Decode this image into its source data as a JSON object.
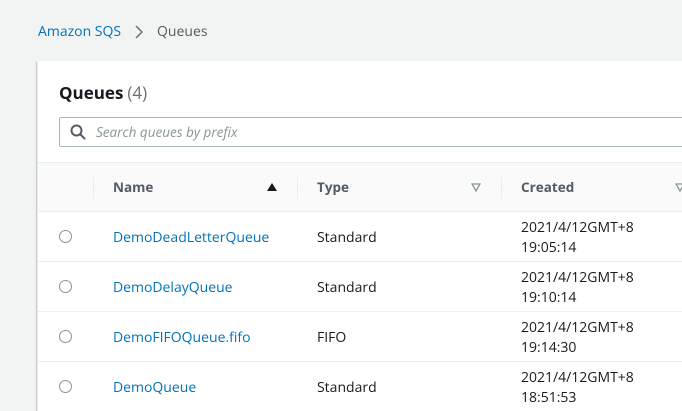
{
  "breadcrumb": {
    "root": "Amazon SQS",
    "current": "Queues"
  },
  "panel": {
    "title": "Queues",
    "count": "(4)"
  },
  "search": {
    "placeholder": "Search queues by prefix",
    "icon": "search-icon"
  },
  "table": {
    "columns": {
      "name": "Name",
      "type": "Type",
      "created": "Created"
    },
    "sort": {
      "column": "Name",
      "direction": "ascending"
    },
    "rows": [
      {
        "name": "DemoDeadLetterQueue",
        "type": "Standard",
        "created_date": "2021/4/12GMT+8",
        "created_time": "19:05:14"
      },
      {
        "name": "DemoDelayQueue",
        "type": "Standard",
        "created_date": "2021/4/12GMT+8",
        "created_time": "19:10:14"
      },
      {
        "name": "DemoFIFOQueue.fifo",
        "type": "FIFO",
        "created_date": "2021/4/12GMT+8",
        "created_time": "19:14:30"
      },
      {
        "name": "DemoQueue",
        "type": "Standard",
        "created_date": "2021/4/12GMT+8",
        "created_time": "18:51:53"
      }
    ]
  },
  "colors": {
    "link": "#0073bb",
    "background": "#f2f3f3",
    "text": "#16191f",
    "header_text": "#545b64"
  }
}
